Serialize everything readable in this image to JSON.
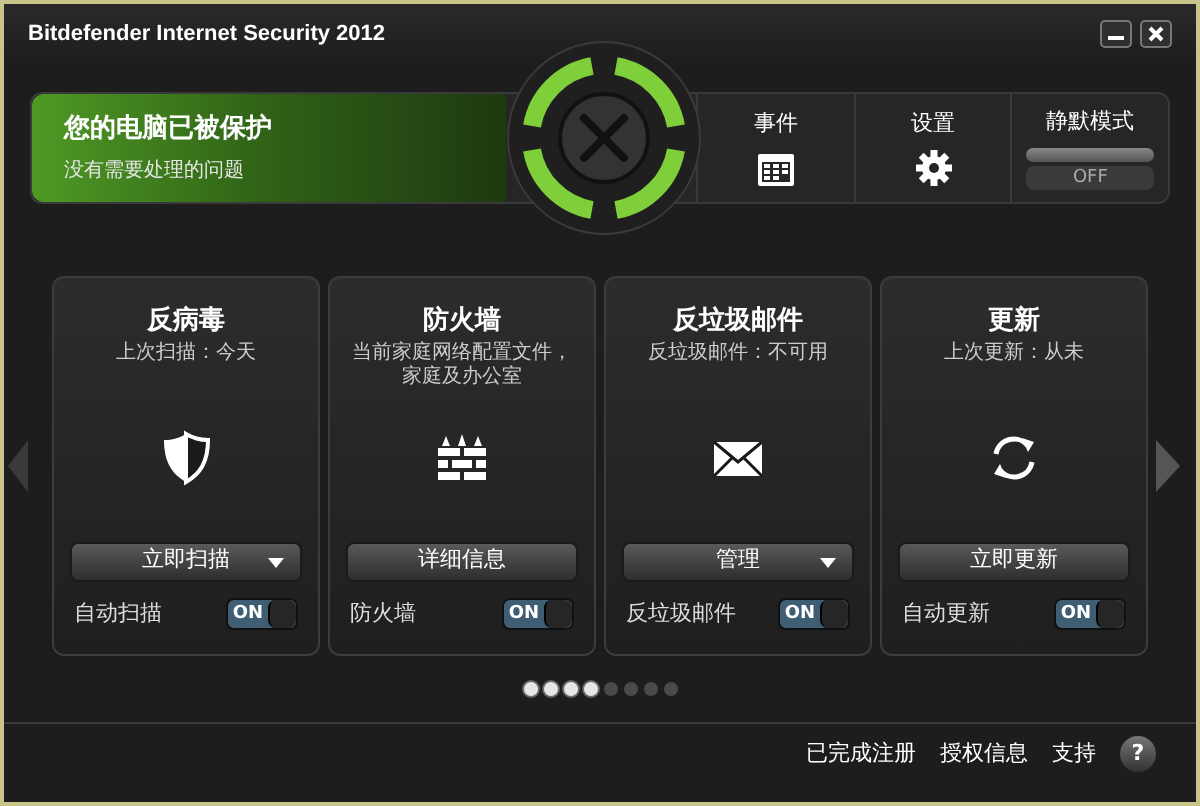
{
  "window": {
    "title": "Bitdefender Internet Security 2012"
  },
  "status": {
    "title": "您的电脑已被保护",
    "subtitle": "没有需要处理的问题"
  },
  "actions": [
    {
      "kind": "calendar",
      "label": "事件"
    },
    {
      "kind": "gear",
      "label": "设置"
    },
    {
      "kind": "toggle",
      "label": "静默模式",
      "state_text": "OFF",
      "on": false
    }
  ],
  "modules": [
    {
      "kind": "shield",
      "title": "反病毒",
      "subtitle": [
        "上次扫描：今天"
      ],
      "button": {
        "label": "立即扫描",
        "dropdown": true
      },
      "toggle": {
        "label": "自动扫描",
        "state_text": "ON",
        "on": true
      }
    },
    {
      "kind": "wall",
      "title": "防火墙",
      "subtitle": [
        "当前家庭网络配置文件，",
        "家庭及办公室"
      ],
      "button": {
        "label": "详细信息",
        "dropdown": false
      },
      "toggle": {
        "label": "防火墙",
        "state_text": "ON",
        "on": true
      }
    },
    {
      "kind": "envelope",
      "title": "反垃圾邮件",
      "subtitle": [
        "反垃圾邮件：不可用"
      ],
      "button": {
        "label": "管理",
        "dropdown": true
      },
      "toggle": {
        "label": "反垃圾邮件",
        "state_text": "ON",
        "on": true
      }
    },
    {
      "kind": "sync",
      "title": "更新",
      "subtitle": [
        "上次更新：从未"
      ],
      "button": {
        "label": "立即更新",
        "dropdown": false
      },
      "toggle": {
        "label": "自动更新",
        "state_text": "ON",
        "on": true
      }
    }
  ],
  "pages": [
    {
      "selected": true
    },
    {
      "selected": true
    },
    {
      "selected": true
    },
    {
      "selected": true
    },
    {
      "selected": false
    },
    {
      "selected": false
    },
    {
      "selected": false
    },
    {
      "selected": false
    }
  ],
  "footer": {
    "links": [
      "已完成注册",
      "授权信息",
      "支持"
    ],
    "help": "?"
  }
}
